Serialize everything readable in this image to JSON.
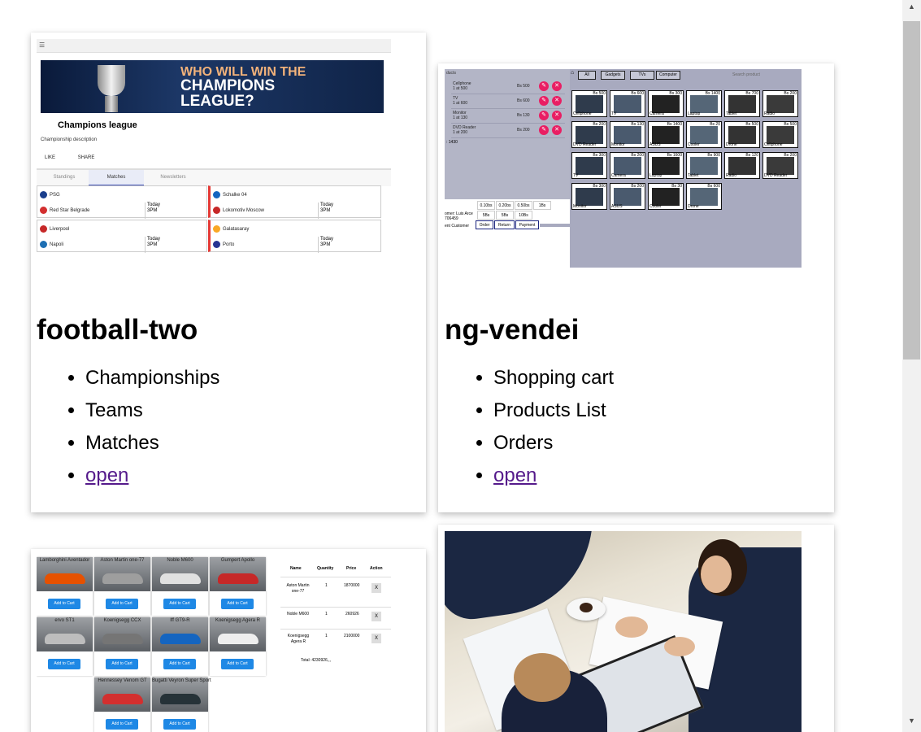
{
  "projects": [
    {
      "title": "football-two",
      "features": [
        "Championships",
        "Teams",
        "Matches"
      ],
      "link": "open",
      "thumb": {
        "banner_line1": "WHO WILL WIN THE",
        "banner_line2": "CHAMPIONS LEAGUE?",
        "title": "Champions league",
        "description": "Championship description",
        "actions": [
          "LIKE",
          "SHARE"
        ],
        "tabs": [
          "Standings",
          "Matches",
          "Newsletters"
        ],
        "active_tab": "Matches",
        "matches": [
          {
            "home": "PSG",
            "away": "Red Star Belgrade",
            "day": "Today",
            "time": "3PM"
          },
          {
            "home": "Schalke 04",
            "away": "Lokomotiv Moscow",
            "day": "Today",
            "time": "3PM"
          },
          {
            "home": "Liverpool",
            "away": "Napoli",
            "day": "Today",
            "time": "3PM"
          },
          {
            "home": "Galatasaray",
            "away": "Porto",
            "day": "Today",
            "time": "3PM"
          }
        ]
      }
    },
    {
      "title": "ng-vendei",
      "features": [
        "Shopping cart",
        "Products List",
        "Orders"
      ],
      "link": "open",
      "thumb": {
        "cart_header": "ducts",
        "cart": [
          {
            "name": "Cellphone",
            "qty": "1 at 500",
            "price": "Bs 500"
          },
          {
            "name": "TV",
            "qty": "1 at 600",
            "price": "Bs 600"
          },
          {
            "name": "Monitor",
            "qty": "1 at 130",
            "price": "Bs 130"
          },
          {
            "name": "DVD Reader",
            "qty": "1 at 200",
            "price": "Bs 200"
          }
        ],
        "total": ": 1430",
        "coins": [
          "0.10bs",
          "0.20bs",
          "0.50bs",
          "1Bs",
          "5Bs",
          "5Bs",
          "10Bs"
        ],
        "customer_name": "omer: Luis Arce",
        "customer_id": "706459",
        "customer_label": "ent Customer",
        "order_buttons": [
          "Order",
          "Return",
          "Payment"
        ],
        "filters": [
          "All",
          "Gadgets",
          "TVs",
          "Computer"
        ],
        "search_placeholder": "Search product",
        "products": [
          {
            "name": "Cellphone",
            "price": "Bs 500"
          },
          {
            "name": "TV",
            "price": "Bs 600"
          },
          {
            "name": "Camera",
            "price": "Bs 300"
          },
          {
            "name": "Laptop",
            "price": "Bs 1400"
          },
          {
            "name": "Tablet",
            "price": "Bs 700"
          },
          {
            "name": "Radio",
            "price": "Bs 200"
          },
          {
            "name": "DVD Reader",
            "price": "Bs 200"
          },
          {
            "name": "Monitor",
            "price": "Bs 130"
          },
          {
            "name": "ASUS",
            "price": "Bs 1400"
          },
          {
            "name": "Cooler",
            "price": "Bs 20"
          },
          {
            "name": "Drone",
            "price": "Bs 500"
          },
          {
            "name": "Cellphone",
            "price": "Bs 500"
          },
          {
            "name": "TV",
            "price": "Bs 300"
          },
          {
            "name": "Camera",
            "price": "Bs 200"
          },
          {
            "name": "Laptop",
            "price": "Bs 1600"
          },
          {
            "name": "Tablet",
            "price": "Bs 900"
          },
          {
            "name": "Radio",
            "price": "Bs 120"
          },
          {
            "name": "DVD Reader",
            "price": "Bs 200"
          },
          {
            "name": "Monitor",
            "price": "Bs 300"
          },
          {
            "name": "ASUS",
            "price": "Bs 200"
          },
          {
            "name": "Cooler",
            "price": "Bs 30"
          },
          {
            "name": "Drone",
            "price": "Bs 600"
          }
        ]
      }
    },
    {
      "thumb": {
        "cars": [
          {
            "name": "Lamborghini Aventador"
          },
          {
            "name": "Aston Martin one-77"
          },
          {
            "name": "Noble M600"
          },
          {
            "name": "Gumpert Apollo"
          },
          {
            "name": "ervo ST1"
          },
          {
            "name": "Koenigsegg CCX"
          },
          {
            "name": "lff GT9-R"
          },
          {
            "name": "Koenigsegg Agera R"
          },
          {
            "name": "Hennessey Venom GT"
          },
          {
            "name": "Bugatti Veyron Super Sport"
          }
        ],
        "add_label": "Add to Cart",
        "table_headers": [
          "Name",
          "Quantity",
          "Price",
          "Action"
        ],
        "rows": [
          {
            "name": "Aston Martin one-77",
            "qty": "1",
            "price": "1870000"
          },
          {
            "name": "Noble M600",
            "qty": "1",
            "price": "260926"
          },
          {
            "name": "Koenigsegg Agera R",
            "qty": "1",
            "price": "2100000"
          }
        ],
        "remove_label": "X",
        "total": "Total: 4230926,,,"
      }
    }
  ],
  "scrollbar": {
    "up": "▲",
    "down": "▼"
  }
}
